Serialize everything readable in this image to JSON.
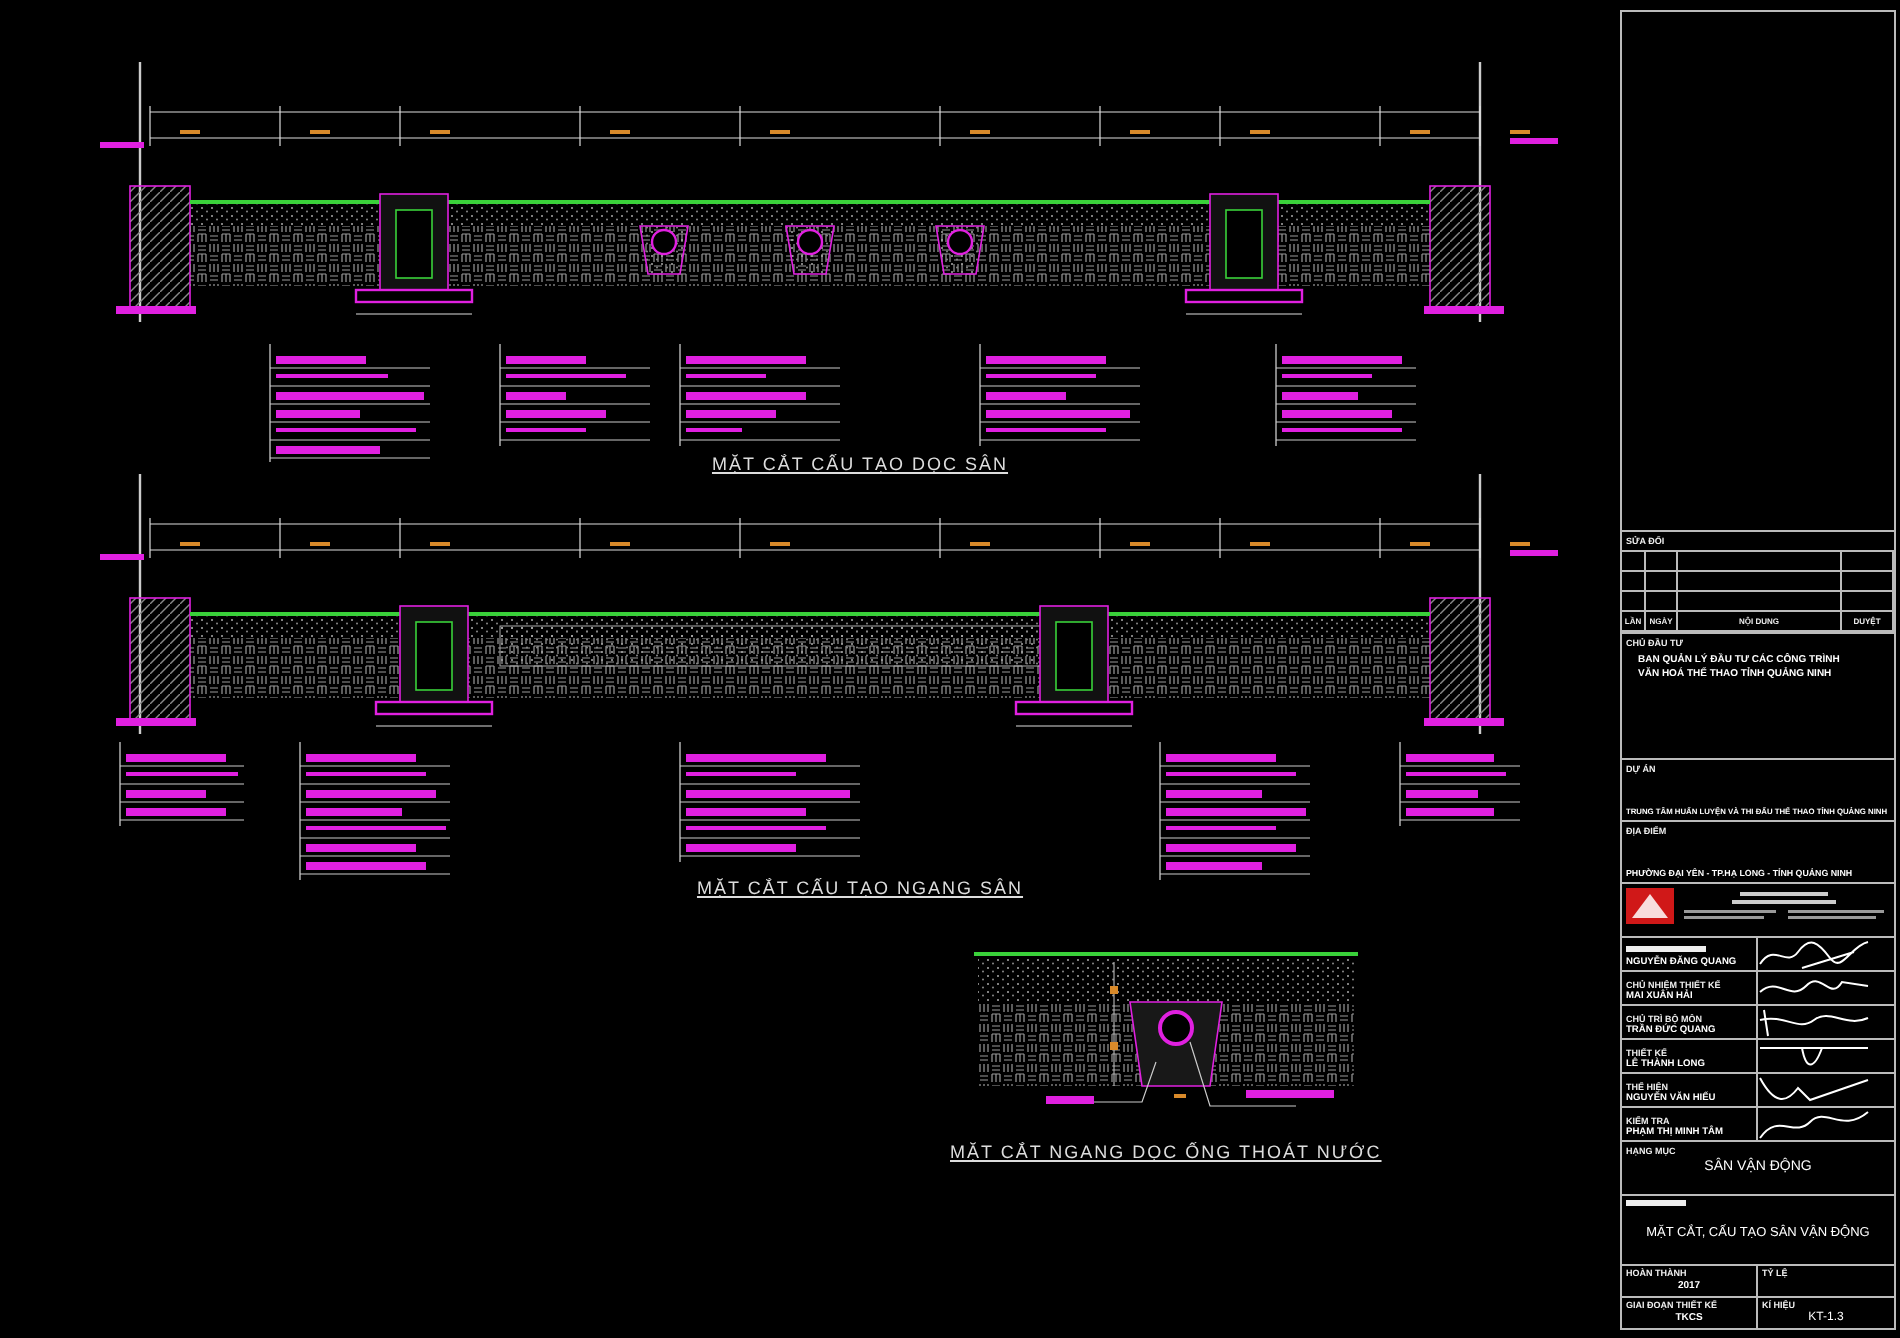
{
  "drawings": [
    {
      "kind": "longitudinal",
      "title": "MẶT CẮT CẤU TẠO DỌC SÂN"
    },
    {
      "kind": "transverse",
      "title": "MẶT CẮT CẤU TẠO NGANG SÂN"
    },
    {
      "kind": "pipe",
      "title": "MẶT CẮT NGANG DỌC ỐNG THOÁT NƯỚC"
    }
  ],
  "title_block": {
    "revision": {
      "heading": "SỬA ĐỔI",
      "columns": [
        "LẦN",
        "NGÀY",
        "NỘI DUNG",
        "DUYỆT"
      ]
    },
    "owner": {
      "label": "CHỦ ĐẦU TƯ",
      "lines": [
        "BAN QUẢN LÝ ĐẦU TƯ CÁC CÔNG TRÌNH",
        "VĂN HOÁ THỂ THAO TỈNH QUẢNG NINH"
      ]
    },
    "project": {
      "label": "DỰ ÁN",
      "value": "TRUNG TÂM HUẤN LUYỆN VÀ THI ĐẤU THỂ THAO TỈNH QUẢNG NINH"
    },
    "location": {
      "label": "ĐỊA ĐIỂM",
      "value": "PHƯỜNG ĐẠI YÊN - TP.HẠ LONG - TỈNH QUẢNG NINH"
    },
    "signatures": [
      {
        "name": "NGUYỄN ĐĂNG QUANG"
      },
      {
        "role": "CHỦ NHIỆM THIẾT KẾ",
        "name": "MAI XUÂN HẢI"
      },
      {
        "role": "CHỦ TRÌ BỘ MÔN",
        "name": "TRẦN ĐỨC QUANG"
      },
      {
        "role": "THIẾT KẾ",
        "name": "LÊ THÀNH LONG"
      },
      {
        "role": "THỂ HIỆN",
        "name": "NGUYỄN VĂN HIẾU"
      },
      {
        "role": "KIỂM TRA",
        "name": "PHẠM THỊ MINH TÂM"
      }
    ],
    "item": {
      "label": "HẠNG MỤC",
      "value": "SÂN VẬN ĐỘNG"
    },
    "drawing_name": {
      "value": "MẶT CẮT, CẤU TẠO SÂN VẬN ĐỘNG"
    },
    "completed": {
      "label": "HOÀN THÀNH",
      "value": "2017"
    },
    "scale": {
      "label": "TỶ LỆ"
    },
    "stage": {
      "label": "GIAI ĐOẠN THIẾT KẾ",
      "value": "TKCS"
    },
    "sheet": {
      "label": "KÍ HIỆU",
      "value": "KT-1.3"
    }
  }
}
